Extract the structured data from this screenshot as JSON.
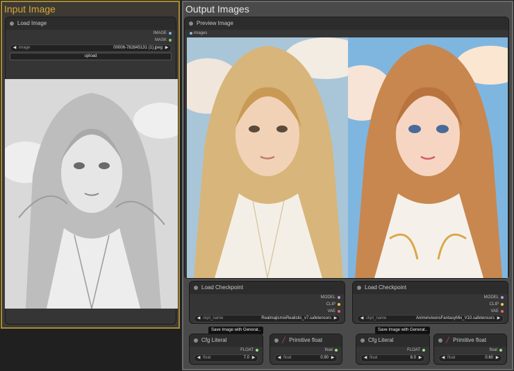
{
  "groups": {
    "input": {
      "title": "Input Image"
    },
    "output": {
      "title": "Output Images"
    }
  },
  "load_image": {
    "title": "Load Image",
    "outputs": [
      "IMAGE",
      "MASK"
    ],
    "image_widget": {
      "name": "image",
      "value": "00006-782845131 (1).jpeg"
    },
    "upload_label": "upload"
  },
  "preview_image": {
    "title": "Preview Image",
    "input_label": "images"
  },
  "checkpoints": [
    {
      "title": "Load Checkpoint",
      "outputs": [
        "MODEL",
        "CLIP",
        "VAE"
      ],
      "widget": {
        "name": "ckpt_name",
        "value": "RealmajicmixRealistic_v7.safetensors"
      }
    },
    {
      "title": "Load Checkpoint",
      "outputs": [
        "MODEL",
        "CLIP",
        "VAE"
      ],
      "widget": {
        "name": "ckpt_name",
        "value": "Anime\\vixonsFantasyMix_V10.safetensors"
      }
    }
  ],
  "tooltips": [
    "Save Image with Generat..",
    "Save Image with Generat.."
  ],
  "cfg_nodes": [
    {
      "title": "Cfg Literal",
      "output": "FLOAT",
      "widget": {
        "name": "float",
        "value": "7.0"
      }
    },
    {
      "title": "Cfg Literal",
      "output": "FLOAT",
      "widget": {
        "name": "float",
        "value": "8.0"
      }
    }
  ],
  "primitive_nodes": [
    {
      "title": "Primitive float",
      "output": "float",
      "widget": {
        "name": "float",
        "value": "0.90"
      }
    },
    {
      "title": "Primitive float",
      "output": "float",
      "widget": {
        "name": "float",
        "value": "0.60"
      }
    }
  ],
  "colors": {
    "input_group_accent": "#d9a53a",
    "model_pin": "#b39ddb",
    "clip_pin": "#f7c948",
    "vae_pin": "#f06262",
    "float_pin": "#9be08a"
  }
}
